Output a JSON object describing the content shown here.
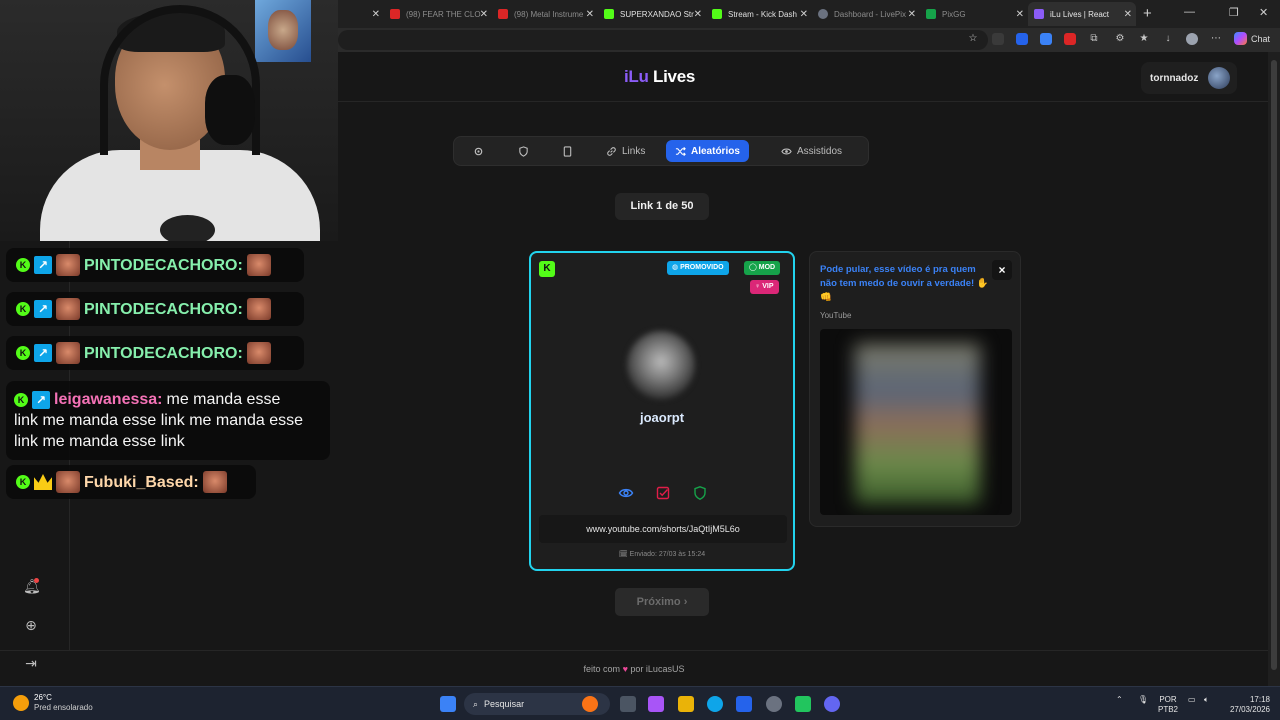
{
  "browser": {
    "tabs": [
      {
        "title": "",
        "color": "#3a3a3a"
      },
      {
        "title": "(98) FEAR THE CLO",
        "color": "#dc2626"
      },
      {
        "title": "(98) Metal Instrume",
        "color": "#dc2626"
      },
      {
        "title": "SUPERXANDAO Str",
        "color": "#53fc18"
      },
      {
        "title": "Stream - Kick Dash",
        "color": "#53fc18"
      },
      {
        "title": "Dashboard - LivePix",
        "color": "#6b7280"
      },
      {
        "title": "PixGG",
        "color": "#16a34a"
      },
      {
        "title": "iLu Lives | React",
        "color": "#8b5cf6"
      }
    ],
    "chat_label": "Chat"
  },
  "site": {
    "logo": {
      "part1": "iLu",
      "part2": "Lives"
    },
    "user": {
      "name": "tornnadoz"
    },
    "tabs": [
      {
        "label": "",
        "icon": "gear-icon"
      },
      {
        "label": "",
        "icon": "shield-icon"
      },
      {
        "label": "",
        "icon": "bookmark-icon"
      },
      {
        "label": "Links",
        "icon": "link-icon"
      },
      {
        "label": "Aleatórios",
        "icon": "shuffle-icon",
        "active": true
      },
      {
        "label": "Assistidos",
        "icon": "eye-icon"
      }
    ],
    "counter": "Link 1 de 50",
    "card": {
      "platform_badge": "K",
      "badges": {
        "promo": "PROMOVIDO",
        "mod": "MOD",
        "vip": "VIP"
      },
      "username": "joaorpt",
      "link": "www.youtube.com/shorts/JaQtIjM5L6o",
      "sent": "Enviado: 27/03 às 15:24"
    },
    "preview": {
      "title": "Pode pular, esse vídeo é pra quem não tem medo de ouvir a verdade! ✋👊",
      "source": "YouTube",
      "close": "×"
    },
    "next_button": "Próximo ›",
    "footer": {
      "prefix": "feito com",
      "heart": "♥",
      "suffix": "por iLucasUS"
    }
  },
  "chat": {
    "messages": [
      {
        "user": "PINTODECACHORO:",
        "text": "",
        "color": "green"
      },
      {
        "user": "PINTODECACHORO:",
        "text": "",
        "color": "green"
      },
      {
        "user": "PINTODECACHORO:",
        "text": "",
        "color": "green"
      },
      {
        "user": "leigawanessa:",
        "text": "me manda esse link me manda esse link me manda esse link me manda esse link",
        "line1": "me manda esse",
        "line2": "link me manda esse link me manda esse",
        "line3": "link me manda esse link",
        "color": "pink"
      },
      {
        "user": "Fubuki_Based:",
        "text": "",
        "color": "peach"
      }
    ]
  },
  "taskbar": {
    "weather": {
      "temp": "26°C",
      "desc": "Pred ensolarado"
    },
    "search": "Pesquisar",
    "lang": {
      "l1": "POR",
      "l2": "PTB2"
    },
    "clock": {
      "time": "17:18",
      "date": "27/03/2026"
    }
  }
}
